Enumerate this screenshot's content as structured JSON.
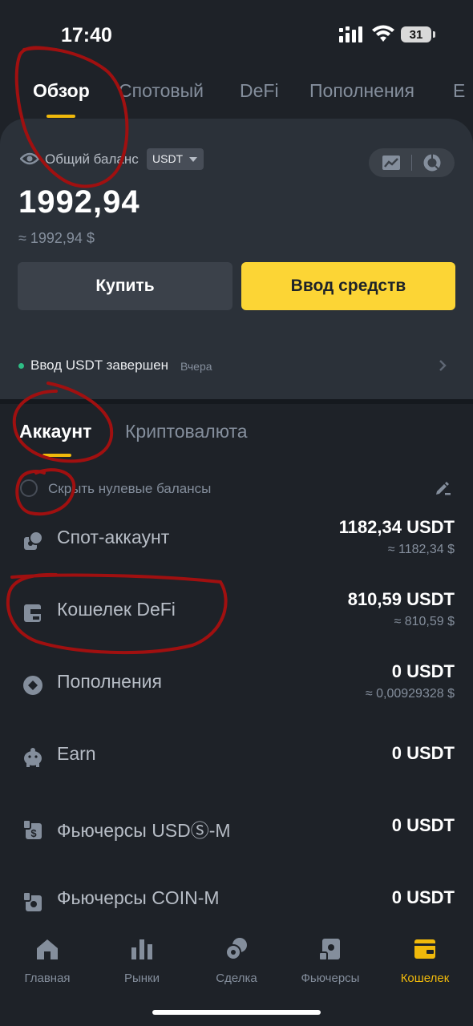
{
  "status_bar": {
    "time": "17:40",
    "battery": "31"
  },
  "top_tabs": [
    "Обзор",
    "Спотовый",
    "DeFi",
    "Пополнения",
    "E"
  ],
  "balance": {
    "label": "Общий баланс",
    "currency": "USDT",
    "value": "1992,94",
    "fiat": "≈ 1992,94 $",
    "buy_label": "Купить",
    "deposit_label": "Ввод средств"
  },
  "notice": {
    "text": "Ввод USDT завершен",
    "time": "Вчера"
  },
  "sub_tabs": [
    "Аккаунт",
    "Криптовалюта"
  ],
  "hide_zero_label": "Скрыть нулевые балансы",
  "accounts": [
    {
      "name": "Спот-аккаунт",
      "value": "1182,34 USDT",
      "fiat": "≈ 1182,34 $",
      "icon": "spot-icon"
    },
    {
      "name": "Кошелек DeFi",
      "value": "810,59 USDT",
      "fiat": "≈ 810,59 $",
      "icon": "defi-wallet-icon"
    },
    {
      "name": "Пополнения",
      "value": "0 USDT",
      "fiat": "≈ 0,00929328 $",
      "icon": "funding-icon"
    },
    {
      "name": "Earn",
      "value": "0 USDT",
      "fiat": "",
      "icon": "earn-icon"
    },
    {
      "name": "Фьючерсы USDⓈ-M",
      "value": "0 USDT",
      "fiat": "",
      "icon": "futures-usdm-icon"
    },
    {
      "name": "Фьючерсы COIN-M",
      "value": "0 USDT",
      "fiat": "",
      "icon": "futures-coinm-icon"
    }
  ],
  "bottom_nav": [
    "Главная",
    "Рынки",
    "Сделка",
    "Фьючерсы",
    "Кошелек"
  ],
  "colors": {
    "accent": "#f0b90b",
    "button_yellow": "#fcd535",
    "success": "#2ebd85",
    "annotation": "#a01010"
  }
}
